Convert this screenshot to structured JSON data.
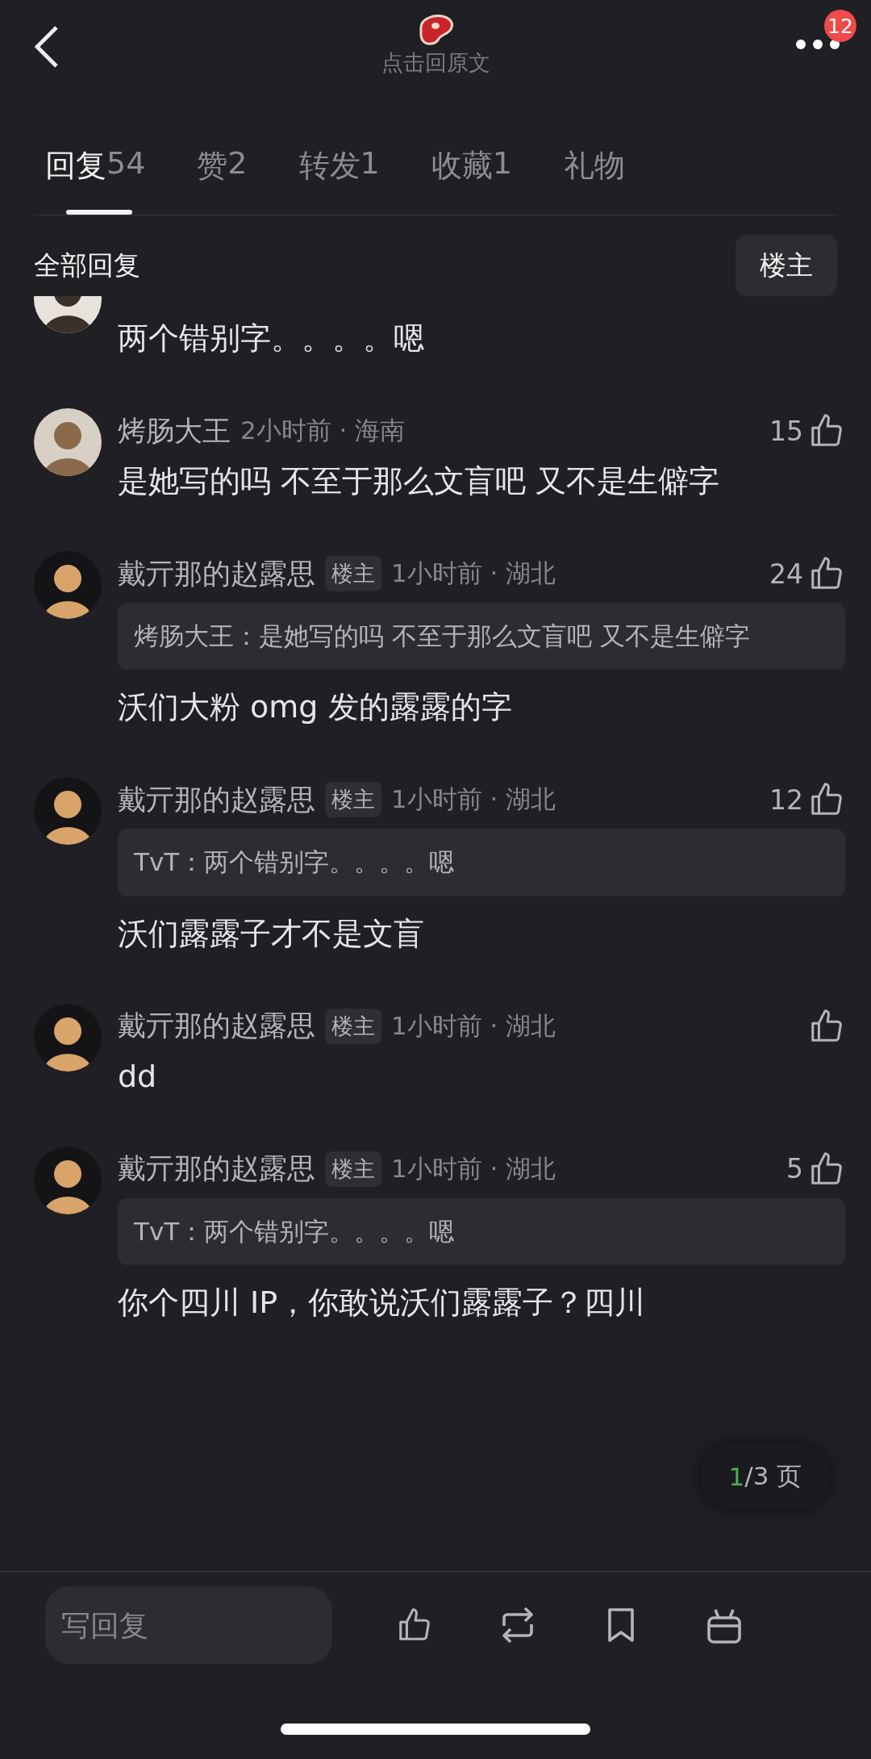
{
  "header": {
    "title": "点击回原文",
    "badge": "12"
  },
  "tabs": [
    {
      "label": "回复",
      "count": "54",
      "selected": true
    },
    {
      "label": "赞",
      "count": "2",
      "selected": false
    },
    {
      "label": "转发",
      "count": "1",
      "selected": false
    },
    {
      "label": "收藏",
      "count": "1",
      "selected": false
    },
    {
      "label": "礼物",
      "selected": false
    }
  ],
  "filter": {
    "title": "全部回复",
    "button": "楼主"
  },
  "comments": [
    {
      "text": "两个错别字。。。。嗯"
    },
    {
      "name": "烤肠大王",
      "meta": "2小时前 · 海南",
      "likes": "15",
      "text": "是她写的吗 不至于那么文盲吧 又不是生僻字"
    },
    {
      "name": "戴亓那的赵露思",
      "op_badge": "楼主",
      "meta": "1小时前 · 湖北",
      "likes": "24",
      "quote": "烤肠大王：是她写的吗 不至于那么文盲吧 又不是生僻字",
      "text": "沃们大粉 omg 发的露露的字"
    },
    {
      "name": "戴亓那的赵露思",
      "op_badge": "楼主",
      "meta": "1小时前 · 湖北",
      "likes": "12",
      "quote": "TvT：两个错别字。。。。嗯",
      "text": "沃们露露子才不是文盲"
    },
    {
      "name": "戴亓那的赵露思",
      "op_badge": "楼主",
      "meta": "1小时前 · 湖北",
      "text": "dd"
    },
    {
      "name": "戴亓那的赵露思",
      "op_badge": "楼主",
      "meta": "1小时前 · 湖北",
      "likes": "5",
      "quote": "TvT：两个错别字。。。。嗯",
      "text": "你个四川 IP，你敢说沃们露露子？四川"
    }
  ],
  "pager": {
    "current": "1",
    "total": "/3 页"
  },
  "reply_bar": {
    "placeholder": "写回复"
  }
}
